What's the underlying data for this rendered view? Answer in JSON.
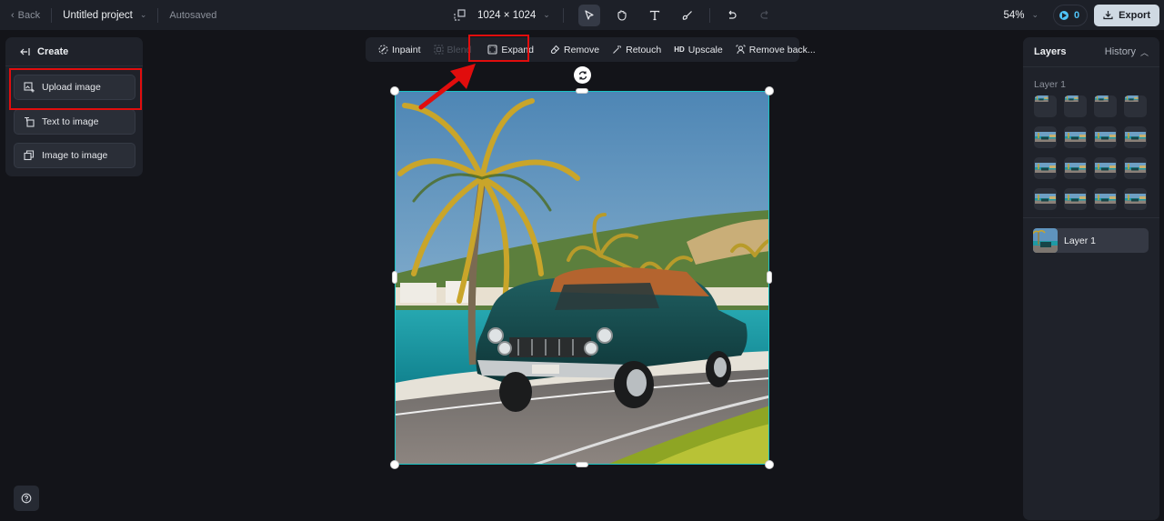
{
  "topbar": {
    "back_label": "Back",
    "project_name": "Untitled project",
    "save_status": "Autosaved",
    "canvas_size": "1024 × 1024",
    "zoom_level": "54%",
    "credits": "0",
    "export_label": "Export",
    "tools": [
      {
        "name": "select",
        "active": true
      },
      {
        "name": "hand",
        "active": false
      },
      {
        "name": "text",
        "active": false
      },
      {
        "name": "brush",
        "active": false
      },
      {
        "name": "undo",
        "active": false
      },
      {
        "name": "redo",
        "active": false,
        "disabled": true
      }
    ]
  },
  "create_panel": {
    "title": "Create",
    "items": [
      {
        "label": "Upload image",
        "icon": "upload-image-icon",
        "highlighted": true
      },
      {
        "label": "Text to image",
        "icon": "text-to-image-icon"
      },
      {
        "label": "Image to image",
        "icon": "image-to-image-icon"
      }
    ]
  },
  "edit_toolbar": {
    "items": [
      {
        "label": "Inpaint",
        "icon": "inpaint-icon",
        "disabled": false
      },
      {
        "label": "Blend",
        "icon": "blend-icon",
        "disabled": true
      },
      {
        "label": "Expand",
        "icon": "expand-icon",
        "disabled": false,
        "highlighted": true
      },
      {
        "label": "Remove",
        "icon": "eraser-icon",
        "disabled": false
      },
      {
        "label": "Retouch",
        "icon": "magic-wand-icon",
        "disabled": false
      },
      {
        "label": "Upscale",
        "icon_text": "HD",
        "disabled": false
      },
      {
        "label": "Remove back...",
        "icon": "remove-background-icon",
        "disabled": false
      }
    ]
  },
  "layers_panel": {
    "title": "Layers",
    "history_label": "History",
    "section_label": "Layer 1",
    "thumbnail_count": 16,
    "layers": [
      {
        "name": "Layer 1",
        "selected": true
      }
    ]
  },
  "annotation": {
    "color": "#e10d0d",
    "arrow_target": "Expand"
  },
  "colors": {
    "accent_selection": "#19c3c3",
    "highlight_red": "#e10d0d",
    "credit_blue": "#4fc3f7"
  }
}
